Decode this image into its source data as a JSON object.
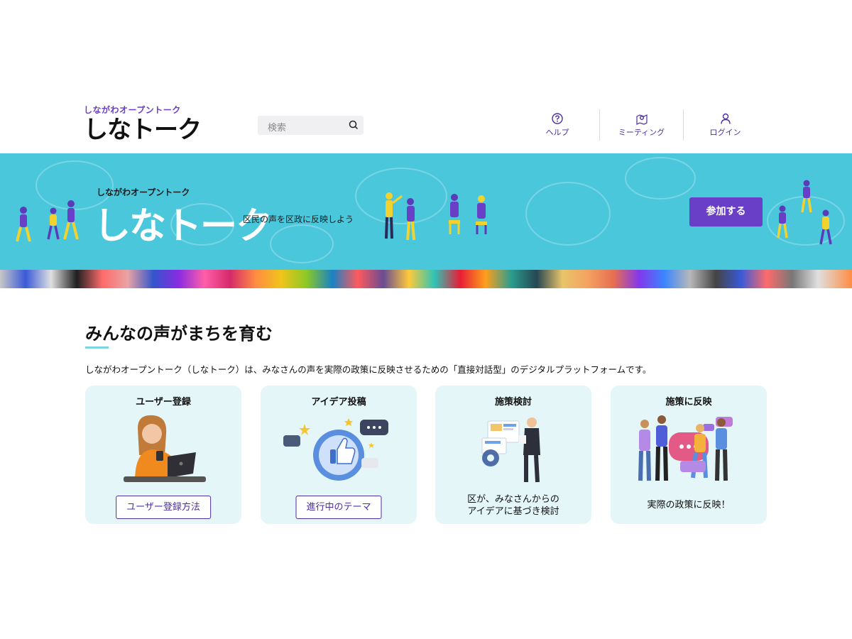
{
  "header": {
    "logo_sub": "しながわオープントーク",
    "logo_main": "しなトーク",
    "search_placeholder": "検索",
    "nav": [
      {
        "label": "ヘルプ",
        "icon": "help-circle-icon"
      },
      {
        "label": "ミーティング",
        "icon": "map-pin-icon"
      },
      {
        "label": "ログイン",
        "icon": "user-icon"
      }
    ]
  },
  "banner": {
    "sub": "しながわオープントーク",
    "title": "しなトーク",
    "tagline": "区民の声を区政に反映しよう",
    "join_label": "参加する",
    "background_color": "#4bc7dc",
    "accent_color": "#6a3fc8"
  },
  "main": {
    "title": "みんなの声がまちを育む",
    "description": "しながわオープントーク（しなトーク）は、みなさんの声を実際の政策に反映させるための「直接対話型」のデジタルプラットフォームです。",
    "cards": [
      {
        "title": "ユーザー登録",
        "button": "ユーザー登録方法",
        "illustration": "person-laptop-illustration"
      },
      {
        "title": "アイデア投稿",
        "button": "進行中のテーマ",
        "illustration": "thumbs-up-chat-illustration"
      },
      {
        "title": "施策検討",
        "text_line1": "区が、みなさんからの",
        "text_line2": "アイデアに基づき検討",
        "illustration": "presenter-dashboard-illustration"
      },
      {
        "title": "施策に反映",
        "text_line1": "実際の政策に反映！",
        "illustration": "celebrating-group-illustration"
      }
    ]
  }
}
